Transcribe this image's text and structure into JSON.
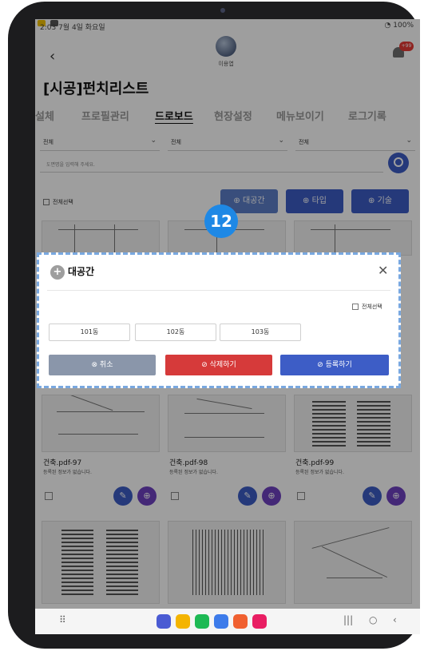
{
  "status_bar": {
    "time": "2:03  7월 4일 화요일",
    "battery": "100%"
  },
  "header": {
    "user_name": "이용엽",
    "notification_badge": "+99",
    "page_title": "[시공]펀치리스트"
  },
  "tabs": [
    "설체",
    "프로필관리",
    "드로보드",
    "현장설정",
    "메뉴보이기",
    "로그기록"
  ],
  "filters": {
    "select1": "전체",
    "select2": "전체",
    "select3": "전체"
  },
  "search": {
    "placeholder": "도면명을 입력해 주세요."
  },
  "select_all": "전체선택",
  "filter_buttons": {
    "space": "대공간",
    "type": "타입",
    "tech": "기술"
  },
  "cards": [
    {
      "name": "건축.pdf-97",
      "desc": "등록된 정보가 없습니다."
    },
    {
      "name": "건축.pdf-98",
      "desc": "등록된 정보가 없습니다."
    },
    {
      "name": "건축.pdf-99",
      "desc": "등록된 정보가 없습니다."
    }
  ],
  "step_number": "12",
  "modal": {
    "title": "대공간",
    "select_all": "전체선택",
    "options": [
      "101동",
      "102동",
      "103동"
    ],
    "cancel": "취소",
    "delete": "삭제하기",
    "register": "등록하기"
  },
  "colors": {
    "primary": "#3d5dc6",
    "danger": "#d63a3a",
    "muted": "#8a96aa",
    "highlight_frame": "#79a8e0",
    "step_badge": "#1e88e5"
  }
}
